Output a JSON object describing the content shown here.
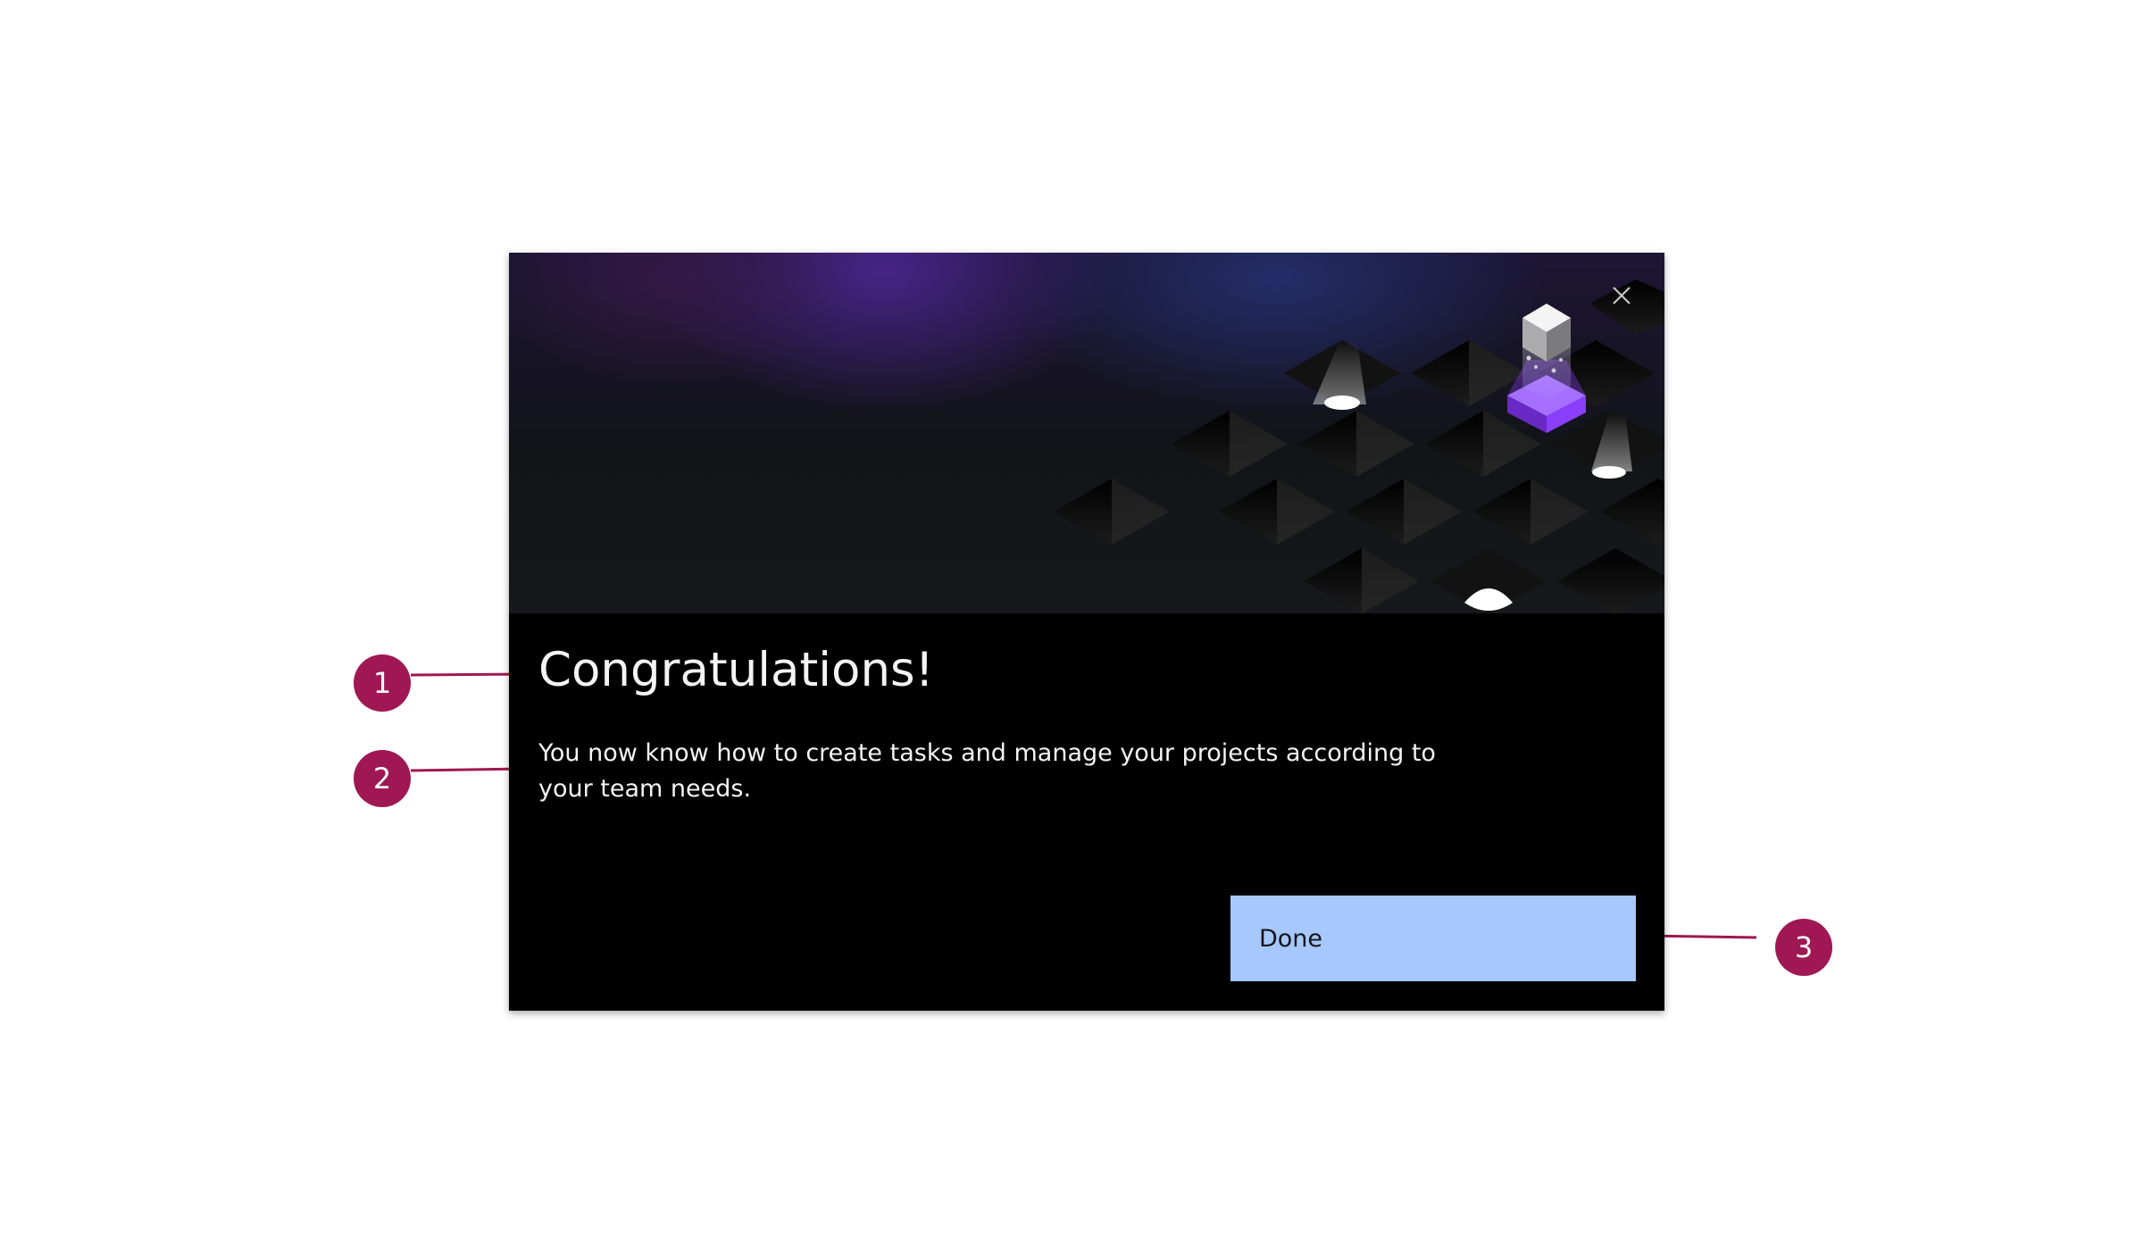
{
  "modal": {
    "title": "Congratulations!",
    "body": "You now know how to create tasks and manage your projects according to your team needs.",
    "close_icon": "close-icon",
    "primary_button_label": "Done"
  },
  "hero": {
    "illustration": "isometric-tiles-cube-illustration"
  },
  "annotations": [
    {
      "number": "1",
      "target": "title"
    },
    {
      "number": "2",
      "target": "body"
    },
    {
      "number": "3",
      "target": "done-button"
    }
  ],
  "colors": {
    "modal_background": "#000000",
    "primary_button": "#a6c8ff",
    "callout": "#9f1853",
    "accent_purple": "#8a3ffc",
    "text": "#f4f4f4"
  }
}
